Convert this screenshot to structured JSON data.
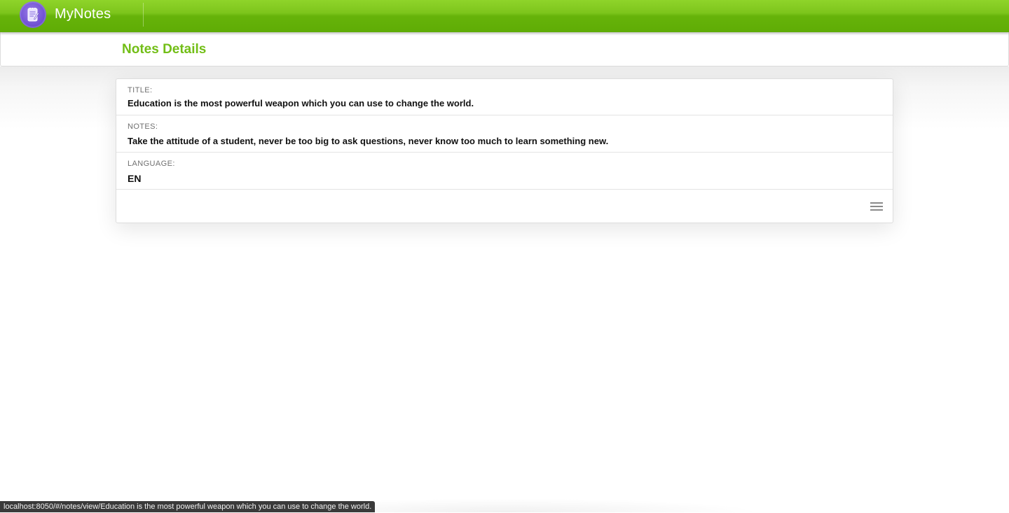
{
  "app": {
    "title": "MyNotes",
    "logo_icon": "notepad-icon",
    "brand_color": "#6ab812",
    "logo_color": "#7152d4"
  },
  "page": {
    "title": "Notes Details",
    "title_color": "#72be16"
  },
  "note": {
    "fields": [
      {
        "label": "TITLE:",
        "value": "Education is the most powerful weapon which you can use to change the world."
      },
      {
        "label": "NOTES:",
        "value": "Take the attitude of a student, never be too big to ask questions, never know too much to learn something new."
      },
      {
        "label": "LANGUAGE:",
        "value": "EN"
      }
    ],
    "menu_icon": "hamburger-menu-icon"
  },
  "status_bar": {
    "url": "localhost:8050/#/notes/view/Education is the most powerful weapon which you can use to change the world."
  }
}
